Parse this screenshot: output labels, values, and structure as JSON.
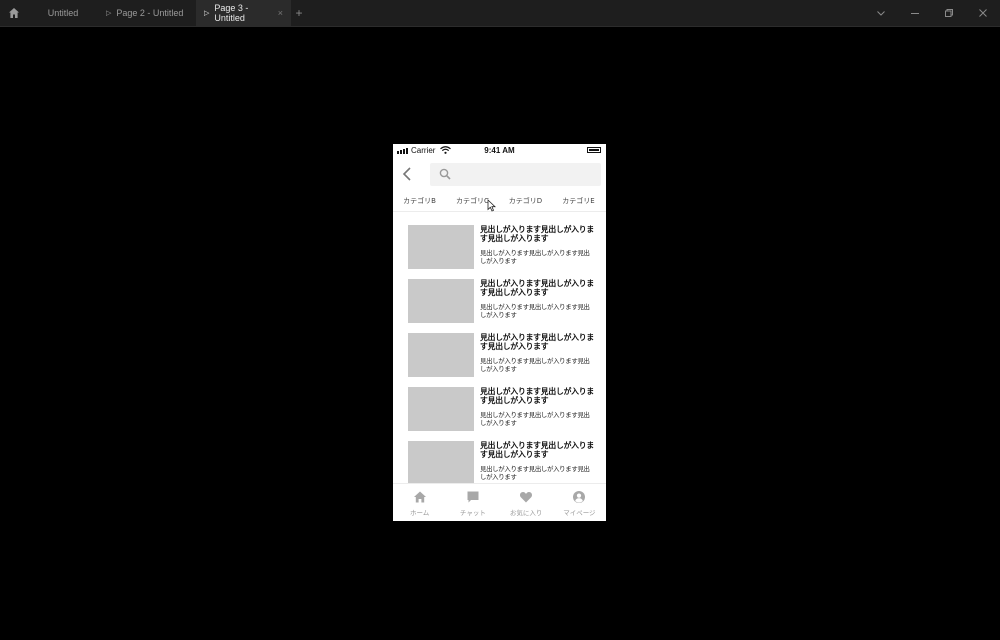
{
  "tabs": [
    {
      "label": "Untitled",
      "playable": false,
      "active": false
    },
    {
      "label": "Page 2 - Untitled",
      "playable": true,
      "active": false
    },
    {
      "label": "Page 3 - Untitled",
      "playable": true,
      "active": true
    }
  ],
  "tab_icons": {
    "play": "▷",
    "close": "×",
    "new": "+"
  },
  "window_controls": [
    "chevron-down-icon",
    "minimize-icon",
    "restore-icon",
    "close-icon"
  ],
  "phone": {
    "status": {
      "carrier": "Carrier",
      "time": "9:41 AM"
    },
    "search": {
      "placeholder": ""
    },
    "categories": [
      "カテゴリB",
      "カテゴリC",
      "カテゴリD",
      "カテゴリE"
    ],
    "items": [
      {
        "title": "見出しが入ります見出しが入ります見出しが入ります",
        "body": "見出しが入ります見出しが入ります見出しが入ります"
      },
      {
        "title": "見出しが入ります見出しが入ります見出しが入ります",
        "body": "見出しが入ります見出しが入ります見出しが入ります"
      },
      {
        "title": "見出しが入ります見出しが入ります見出しが入ります",
        "body": "見出しが入ります見出しが入ります見出しが入ります"
      },
      {
        "title": "見出しが入ります見出しが入ります見出しが入ります",
        "body": "見出しが入ります見出しが入ります見出しが入ります"
      },
      {
        "title": "見出しが入ります見出しが入ります見出しが入ります",
        "body": "見出しが入ります見出しが入ります見出しが入ります"
      }
    ],
    "tabbar": [
      {
        "label": "ホーム",
        "icon": "home-icon"
      },
      {
        "label": "チャット",
        "icon": "chat-icon"
      },
      {
        "label": "お気に入り",
        "icon": "heart-icon"
      },
      {
        "label": "マイページ",
        "icon": "user-icon"
      }
    ]
  },
  "colors": {
    "canvas": "#000000",
    "titlebar": "#1e1e1e",
    "active_tab": "#2b2b2b",
    "placeholder_image": "#c9c9c9",
    "icon_gray": "#a8a8a8"
  }
}
